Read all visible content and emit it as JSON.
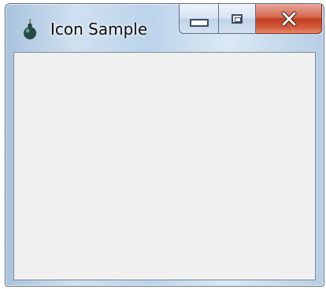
{
  "window": {
    "title": "Icon Sample",
    "icons": {
      "app": "bomb-icon",
      "minimize": "minimize-icon",
      "maximize": "maximize-icon",
      "close": "close-icon"
    }
  },
  "colors": {
    "client_background": "#f0f0f0",
    "frame": "#b9cfe6",
    "close_button": "#c94a2e"
  }
}
